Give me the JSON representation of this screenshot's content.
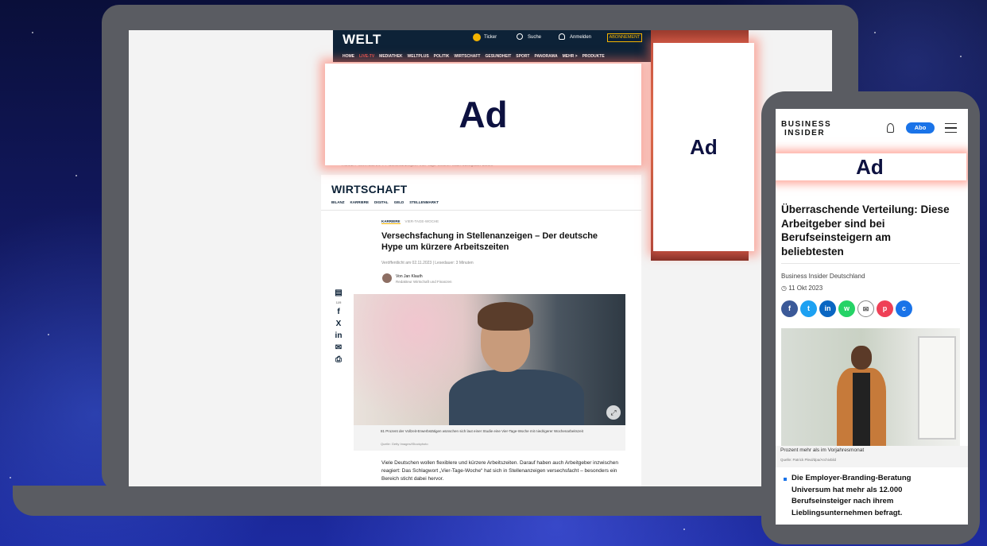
{
  "welt": {
    "logo": "WELT",
    "header_links": {
      "ticker": "Ticker",
      "search": "Suche",
      "login": "Anmelden",
      "abo": "ABONNEMENT"
    },
    "nav": [
      "HOME",
      "LIVE-TV",
      "MEDIATHEK",
      "WELTPLUS",
      "POLITIK",
      "WIRTSCHAFT",
      "GESUNDHEIT",
      "SPORT",
      "PANORAMA",
      "MEHR >",
      "PRODUKTE"
    ],
    "breadcrumb": "HOME > WIRTSCHAFT > Stellenanzeigen: Vier-Tage-Woche: Was Arbeitgeber bieten",
    "section_title": "WIRTSCHAFT",
    "section_nav": [
      "BILANZ",
      "KARRIERE",
      "DIGITAL",
      "GELD",
      "STELLENMARKT"
    ],
    "kicker": [
      "KARRIERE",
      "VIER-TAGE-WOCHE"
    ],
    "headline": "Versechsfachung in Stellenanzeigen – Der deutsche Hype um kürzere Arbeitszeiten",
    "pubdate": "Veröffentlicht am 02.11.2023 | Lesedauer: 3 Minuten",
    "author_name": "Von Jan Klauth",
    "author_role": "Redakteur Wirtschaft und Finanzen",
    "comment_count": "125",
    "caption": "81 Prozent der Vollzeit-Erwerbstätigen wünschen sich laut einer Studie eine Vier-Tage-Woche mit niedrigerer Wochenarbeitszeit",
    "caption_source": "Quelle: Getty Images/iStockphoto",
    "body": "Viele Deutschen wollen flexiblere und kürzere Arbeitszeiten. Darauf haben auch Arbeitgeber inzwischen reagiert: Das Schlagwort „Vier-Tage-Woche“ hat sich in Stellenanzeigen versechsfacht – besonders ein Bereich sticht dabei hervor."
  },
  "ads": {
    "banner": "Ad",
    "skyscraper": "Ad",
    "phone": "Ad"
  },
  "bi": {
    "logo_line1": "BUSINESS",
    "logo_line2": "INSIDER",
    "abo": "Abo",
    "headline": "Überraschende Verteilung: Diese Arbeitgeber sind bei Berufseinsteigern am beliebtesten",
    "source": "Business Insider Deutschland",
    "date": "11 Okt 2023",
    "share_icons": [
      "f",
      "t",
      "in",
      "w",
      "✉",
      "p",
      "c"
    ],
    "caption": "Prozent mehr als im Vorjahresmonat",
    "caption_source": "Quelle: Patrick Pleul/dpa/Archivbild",
    "bullet": "Die Employer-Branding-Beratung Universum hat mehr als 12.000 Berufseinsteiger nach ihrem Lieblingsunternehmen befragt."
  },
  "colors": {
    "welt_navy": "#0d2237",
    "bi_blue": "#1a73e8",
    "ad_glow": "#ff6e5a"
  }
}
